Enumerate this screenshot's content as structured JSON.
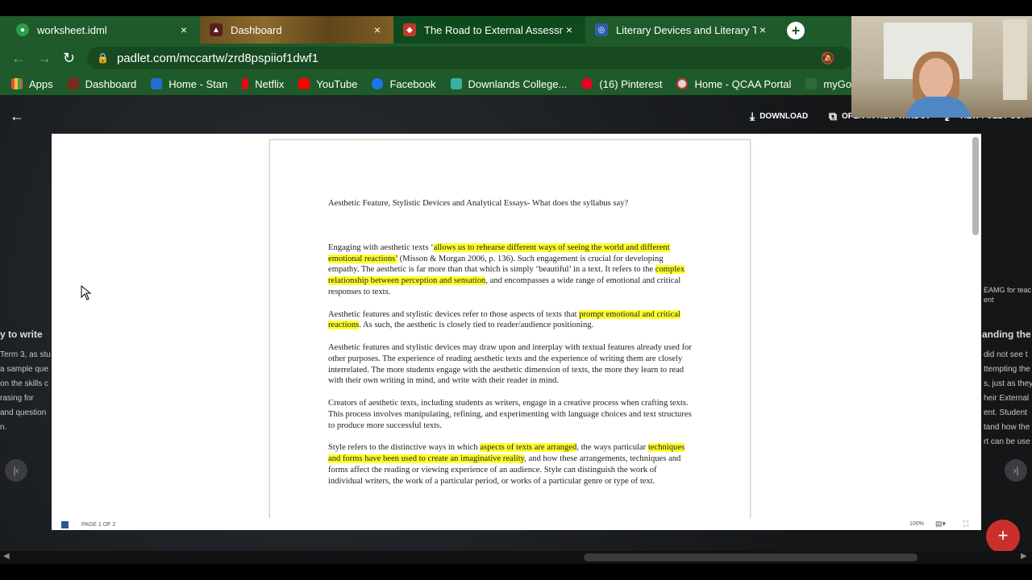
{
  "browser": {
    "tabs": [
      {
        "title": "worksheet.idml",
        "icon": "google-drive-icon",
        "close": "×"
      },
      {
        "title": "Dashboard",
        "icon": "dashboard-icon",
        "close": "×"
      },
      {
        "title": "The Road to External Assessment",
        "icon": "padlet-icon",
        "close": "×"
      },
      {
        "title": "Literary Devices and Literary Term",
        "icon": "web-icon",
        "close": "×"
      }
    ],
    "new_tab": "+",
    "url": "padlet.com/mccartw/zrd8pspiiof1dwf1",
    "bookmarks": [
      "Apps",
      "Dashboard",
      "Home - Stan",
      "Netflix",
      "YouTube",
      "Facebook",
      "Downlands College...",
      "(16) Pinterest",
      "Home - QCAA Portal",
      "myGov - Login"
    ]
  },
  "padlet": {
    "download_label": "DOWNLOAD",
    "open_window_label": "OPEN IN NEW WINDOW",
    "view_full_label": "VIEW FULL POST",
    "bg_left_title": "y to write",
    "bg_left_lines": [
      "Term 3, as stu",
      "a sample que",
      "on the skills c",
      "rasing for",
      "and question",
      "n."
    ],
    "bg_right_title": "anding the i",
    "bg_right_lines": [
      "did not see t",
      "ttempting the",
      "s, just as they",
      "heir External",
      "ent.  Student",
      "tand how the",
      "rt can be use"
    ],
    "bg_right_small": "EAMG for teac",
    "bg_right_small2": "ent"
  },
  "document": {
    "heading": "Aesthetic Feature, Stylistic Devices and Analytical Essays- What does the syllabus say?",
    "p1": [
      "Engaging with aesthetic texts ‘",
      "allows us to rehearse different ways of seeing the world and different emotional reactions’",
      " (Misson & Morgan 2006, p. 136). Such engagement is crucial for developing empathy. The aesthetic is far more than that which is simply ‘beautiful’ in a text. It refers to the ",
      "complex relationship between perception and sensation",
      ", and encompasses a wide range of emotional and critical responses to texts."
    ],
    "p2": [
      "Aesthetic features and stylistic devices refer to those aspects of texts that ",
      "prompt emotional and critical reactions",
      ". As such, the aesthetic is closely tied to reader/audience positioning."
    ],
    "p3": "Aesthetic features and stylistic devices may draw upon and interplay with textual features already used for other purposes. The experience of reading aesthetic texts and the experience of writing them are closely interrelated. The more students engage with the aesthetic dimension of texts, the more they learn to read with their own writing in mind, and write with their reader in mind.",
    "p4": "Creators of aesthetic texts, including students as writers, engage in a creative process when crafting texts. This process involves manipulating, refining, and experimenting with language choices and text structures to produce more successful texts.",
    "p5": [
      "Style refers to the distinctive ways in which ",
      "aspects of texts are arranged",
      ", the ways particular ",
      "techniques and forms have been used to create an imaginative reality",
      ", and how these arrangements, techniques and forms affect the reading or viewing experience of an audience. Style can distinguish the work of individual writers, the work of a particular period, or works of a particular genre or type of text."
    ]
  },
  "viewer": {
    "page_indicator": "PAGE 1 OF 2",
    "zoom": "100%"
  }
}
